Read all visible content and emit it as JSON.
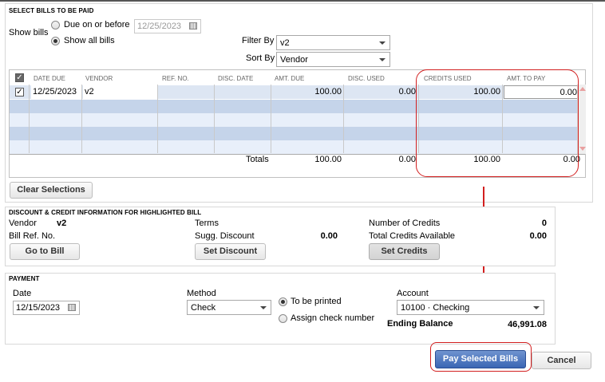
{
  "select_bills": {
    "section_title": "SELECT BILLS TO BE PAID",
    "show_bills_label": "Show bills",
    "due_on_before_label": "Due on or before",
    "due_date": "12/25/2023",
    "show_all_label": "Show all bills",
    "filter_by_label": "Filter By",
    "filter_by_value": "v2",
    "sort_by_label": "Sort By",
    "sort_by_value": "Vendor",
    "selected_option": "show_all"
  },
  "grid": {
    "headers": [
      "DATE DUE",
      "VENDOR",
      "REF. NO.",
      "DISC. DATE",
      "AMT. DUE",
      "DISC. USED",
      "CREDITS USED",
      "AMT. TO PAY"
    ],
    "rows": [
      {
        "checked": true,
        "date_due": "12/25/2023",
        "vendor": "v2",
        "ref_no": "",
        "disc_date": "",
        "amt_due": "100.00",
        "disc_used": "0.00",
        "credits_used": "100.00",
        "amt_to_pay": "0.00"
      }
    ],
    "totals_label": "Totals",
    "totals": {
      "amt_due": "100.00",
      "disc_used": "0.00",
      "credits_used": "100.00",
      "amt_to_pay": "0.00"
    }
  },
  "clear_selections_label": "Clear Selections",
  "discount_credit": {
    "section_title": "DISCOUNT & CREDIT INFORMATION FOR HIGHLIGHTED BILL",
    "vendor_label": "Vendor",
    "vendor_value": "v2",
    "bill_ref_label": "Bill Ref. No.",
    "terms_label": "Terms",
    "sugg_discount_label": "Sugg. Discount",
    "sugg_discount_value": "0.00",
    "num_credits_label": "Number of Credits",
    "num_credits_value": "0",
    "total_credits_label": "Total Credits Available",
    "total_credits_value": "0.00",
    "go_to_bill_label": "Go to Bill",
    "set_discount_label": "Set Discount",
    "set_credits_label": "Set Credits"
  },
  "payment": {
    "section_title": "PAYMENT",
    "date_label": "Date",
    "date_value": "12/15/2023",
    "method_label": "Method",
    "method_value": "Check",
    "to_be_printed_label": "To be printed",
    "assign_check_label": "Assign check number",
    "account_label": "Account",
    "account_value": "10100 · Checking",
    "ending_balance_label": "Ending Balance",
    "ending_balance_value": "46,991.08"
  },
  "footer": {
    "pay_selected_label": "Pay Selected Bills",
    "cancel_label": "Cancel"
  },
  "colors": {
    "annotation_red": "#d21f1f",
    "row_highlight": "#c5d4ea",
    "row_alt": "#e8effa",
    "primary_button": "#3a66b4"
  }
}
